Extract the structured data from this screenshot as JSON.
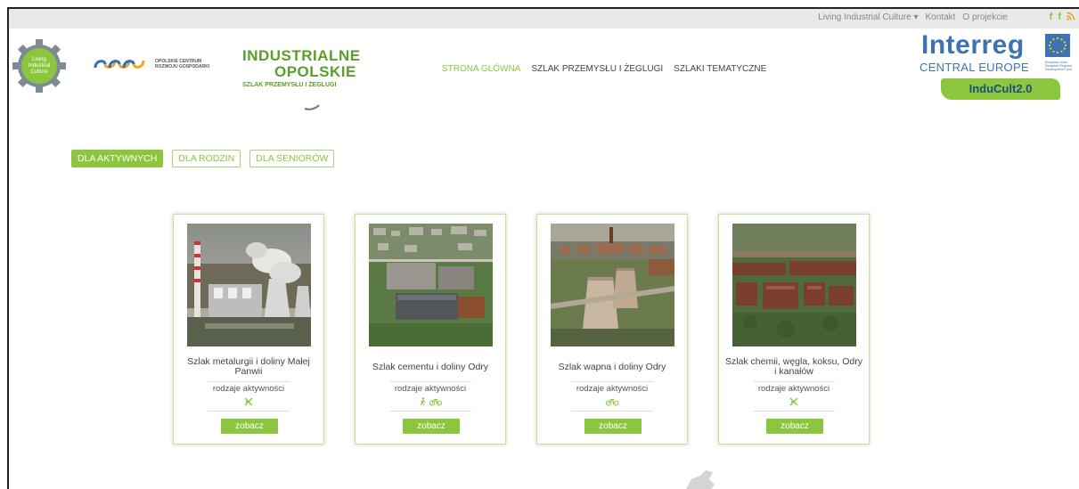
{
  "topbar": {
    "living_label": "Living Industrial Culture ▾",
    "contact_label": "Kontakt",
    "about_label": "O projekcie",
    "facebook1": "f",
    "facebook2": "f",
    "rss": "))"
  },
  "logos": {
    "gear_text": [
      "Living",
      "Industrial",
      "Culture"
    ],
    "cerog_line1": "OPOLSKIE CENTRUM",
    "cerog_line2": "ROZWOJU GOSPODARKI",
    "industrialne_line1": "INDUSTRIALNE",
    "industrialne_line2": "OPOLSKIE",
    "industrialne_line3": "SZLAK PRZEMYSŁU I ŻEGLUGI",
    "interreg": "Interreg",
    "central_europe": "CENTRAL EUROPE",
    "fund_text": "European Union European Regional Development Fund",
    "inducult": "InduCult2.0"
  },
  "nav": {
    "home": "STRONA GŁÓWNA",
    "trail": "SZLAK PRZEMYSŁU I ŻEGLUGI",
    "thematic": "SZLAKI TEMATYCZNE"
  },
  "filters": {
    "active": "DLA AKTYWNYCH",
    "families": "DLA RODZIN",
    "seniors": "DLA SENIORÓW"
  },
  "cards": [
    {
      "title": "Szlak metalurgii i doliny Małej Panwii",
      "activities_label": "rodzaje aktywności",
      "icons": "canoe",
      "button": "zobacz"
    },
    {
      "title": "Szlak cementu i doliny Odry",
      "activities_label": "rodzaje aktywności",
      "icons": "walk bike",
      "button": "zobacz"
    },
    {
      "title": "Szlak wapna i doliny Odry",
      "activities_label": "rodzaje aktywności",
      "icons": "bike",
      "button": "zobacz"
    },
    {
      "title": "Szlak chemii, węgla, koksu, Odry i kanałów",
      "activities_label": "rodzaje aktywności",
      "icons": "canoe",
      "button": "zobacz"
    }
  ],
  "colors": {
    "accent_green": "#8cc63f",
    "interreg_blue": "#3d73b5",
    "industrialne_green": "#5a9e2a"
  }
}
